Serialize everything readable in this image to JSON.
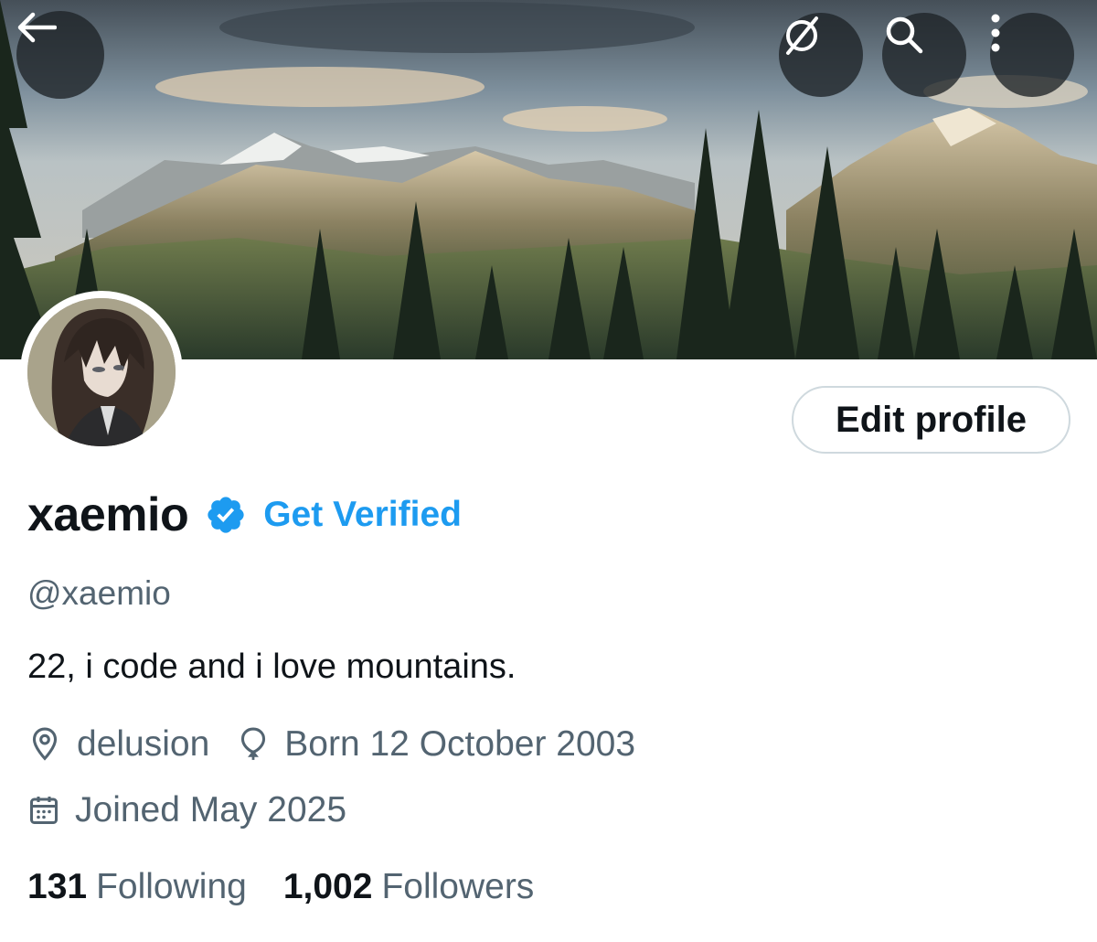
{
  "header": {
    "back_icon": "arrow-left-icon",
    "grok_icon": "grok-slash-circle-icon",
    "search_icon": "search-icon",
    "more_icon": "more-vertical-icon"
  },
  "profile": {
    "display_name": "xaemio",
    "verified_icon": "verified-badge-icon",
    "get_verified_label": "Get Verified",
    "handle": "@xaemio",
    "bio": "22, i code and i love mountains.",
    "location": "delusion",
    "birthday": "Born 12 October 2003",
    "joined": "Joined May 2025",
    "edit_profile_label": "Edit profile"
  },
  "stats": {
    "following_count": "131",
    "following_label": "Following",
    "followers_count": "1,002",
    "followers_label": "Followers"
  },
  "colors": {
    "accent": "#1d9bf0",
    "text_primary": "#0f1419",
    "text_secondary": "#536471",
    "border": "#cfd9de"
  }
}
